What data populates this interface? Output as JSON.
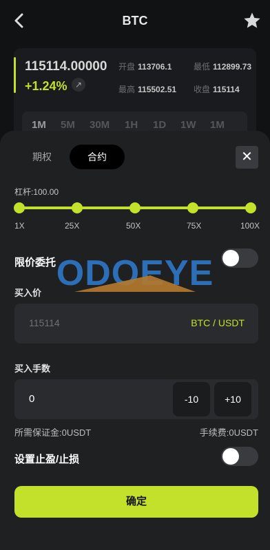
{
  "header": {
    "title": "BTC",
    "back_icon": "chevron-left-icon",
    "favorite_icon": "star-icon"
  },
  "ticker": {
    "price": "115114.00000",
    "change": "+1.24%",
    "change_icon": "arrow-up-right-icon",
    "open_label": "开盘",
    "open_value": "113706.1",
    "low_label": "最低",
    "low_value": "112899.73",
    "high_label": "最高",
    "high_value": "115502.51",
    "close_label": "收盘",
    "close_value": "115114",
    "periods": [
      "1M",
      "5M",
      "30M",
      "1H",
      "1D",
      "1W",
      "1M"
    ],
    "active_period": "1M"
  },
  "sheet": {
    "tabs": {
      "options": "期权",
      "contract": "合约",
      "active": "合约"
    },
    "close_icon": "close-icon",
    "leverage": {
      "label": "杠杆:100.00",
      "value": 100,
      "ticks": [
        "1X",
        "25X",
        "50X",
        "75X",
        "100X"
      ]
    },
    "limit_order": {
      "label": "限价委托",
      "enabled": false
    },
    "buy_price": {
      "label": "买入价",
      "value": "115114",
      "unit": "BTC / USDT"
    },
    "quantity": {
      "label": "买入手数",
      "value": "0",
      "minus": "-10",
      "plus": "+10"
    },
    "margin_required": "所需保证金:0USDT",
    "fee": "手续费:0USDT",
    "stop": {
      "label": "设置止盈/止损",
      "enabled": false
    },
    "confirm": "确定"
  },
  "watermark": {
    "text": "ODOEYE"
  },
  "colors": {
    "accent": "#c3e02b",
    "background": "#111214",
    "sheet": "#1f2022",
    "field": "#2a2b2e"
  }
}
